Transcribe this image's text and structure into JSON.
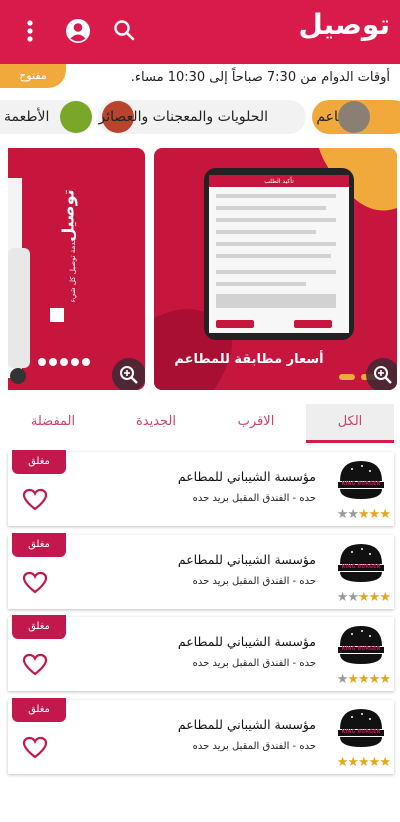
{
  "app": {
    "title": "توصيل"
  },
  "header": {
    "hours_text": "أوقات الدوام من 7:30 صباحاً إلى 10:30 مساء.",
    "open_badge": "مفتوح"
  },
  "categories": [
    {
      "label": "المطاعم",
      "active": true
    },
    {
      "label": "الحلويات والمعجنات والعصائر",
      "active": false
    },
    {
      "label": "الأطعمة",
      "active": false
    }
  ],
  "banners": [
    {
      "headline": "أسعار مطابقة للمطاعم",
      "screen_title": "تأكيد الطلب"
    },
    {
      "headline": "توصيل",
      "subtitle": "خدمة توصيل كل شيء"
    }
  ],
  "tabs": [
    {
      "label": "الكل",
      "active": true
    },
    {
      "label": "الاقرب",
      "active": false
    },
    {
      "label": "الجديدة",
      "active": false
    },
    {
      "label": "المفضلة",
      "active": false
    }
  ],
  "restaurants": [
    {
      "name": "مؤسسة الشيباني للمطاعم",
      "address": "حده - الفندق المقبل بريد حده",
      "status": "مغلق",
      "rating": 3,
      "logo_text": "KING BURGER"
    },
    {
      "name": "مؤسسة الشيباني للمطاعم",
      "address": "حده - الفندق المقبل بريد حده",
      "status": "مغلق",
      "rating": 3,
      "logo_text": "KING BURGER"
    },
    {
      "name": "مؤسسة الشيباني للمطاعم",
      "address": "حده - الفندق المقبل بريد حده",
      "status": "مغلق",
      "rating": 4,
      "logo_text": "KING BURGER"
    },
    {
      "name": "مؤسسة الشيباني للمطاعم",
      "address": "حده - الفندق المقبل بريد حده",
      "status": "مغلق",
      "rating": 5,
      "logo_text": "KING BURGER"
    }
  ],
  "colors": {
    "primary": "#d81b4a",
    "accent": "#f2a93b",
    "star": "#e2a71f"
  },
  "icons": {
    "menu": "more-vert-icon",
    "account": "account-circle-icon",
    "search": "search-icon",
    "zoom": "zoom-in-icon",
    "favorite": "heart-outline-icon"
  }
}
